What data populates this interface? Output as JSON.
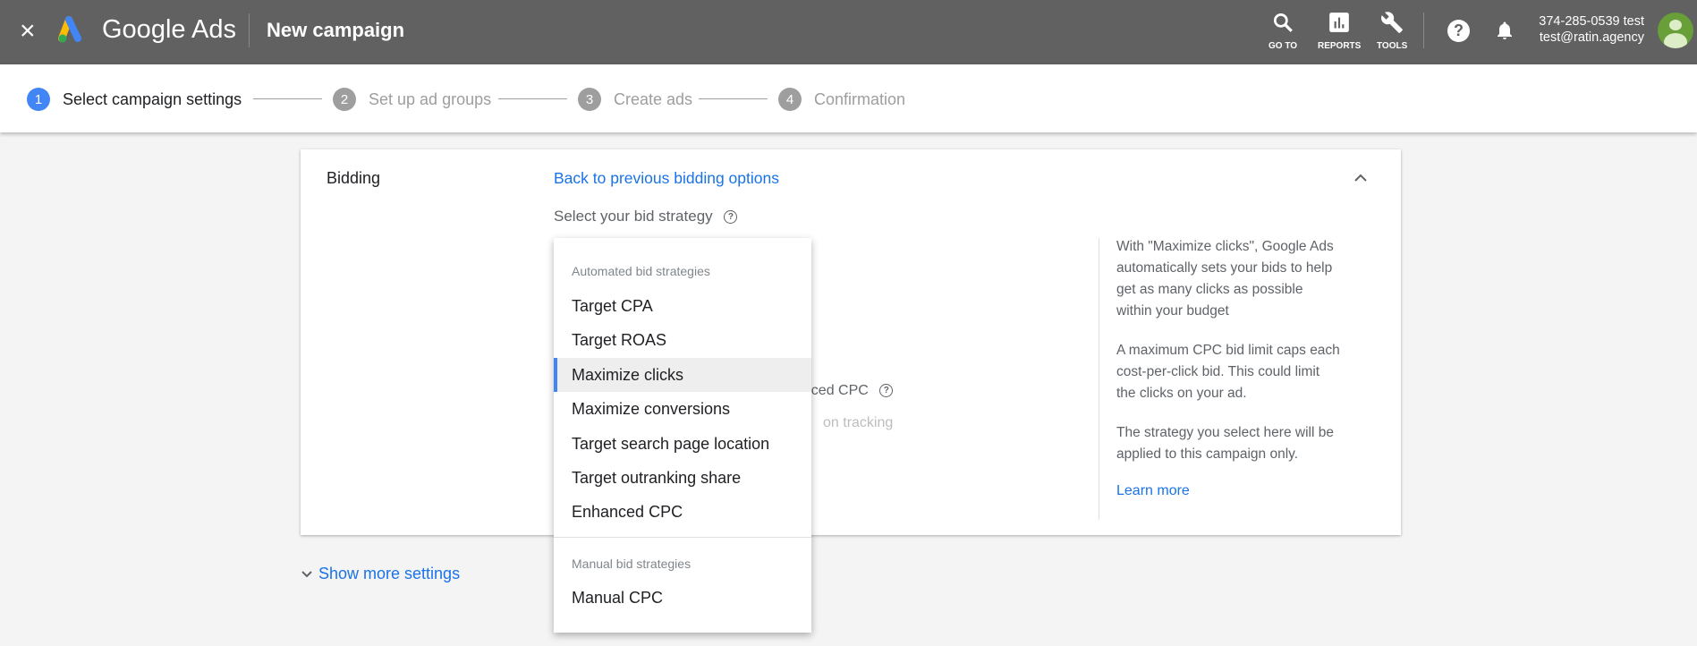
{
  "header": {
    "close_icon": "close-icon",
    "product_name": "Google Ads",
    "page_title": "New campaign",
    "goto_label": "GO TO",
    "reports_label": "REPORTS",
    "tools_label": "TOOLS",
    "account_id": "374-285-0539 test",
    "account_email": "test@ratin.agency"
  },
  "stepper": {
    "steps": [
      {
        "num": "1",
        "label": "Select campaign settings",
        "active": true
      },
      {
        "num": "2",
        "label": "Set up ad groups"
      },
      {
        "num": "3",
        "label": "Create ads"
      },
      {
        "num": "4",
        "label": "Confirmation"
      }
    ]
  },
  "bidding": {
    "section_label": "Bidding",
    "back_link": "Back to previous bidding options",
    "select_label": "Select your bid strategy",
    "behind_text_1": "anced CPC",
    "behind_text_2": "on tracking",
    "help": {
      "p1": "With \"Maximize clicks\", Google Ads automatically sets your bids to help get as many clicks as possible within your budget",
      "p2": "A maximum CPC bid limit caps each cost-per-click bid. This could limit the clicks on your ad.",
      "p3": "The strategy you select here will be applied to this campaign only.",
      "learn_more": "Learn more"
    }
  },
  "dropdown": {
    "automated_header": "Automated bid strategies",
    "automated": [
      "Target CPA",
      "Target ROAS",
      "Maximize clicks",
      "Maximize conversions",
      "Target search page location",
      "Target outranking share",
      "Enhanced CPC"
    ],
    "selected": "Maximize clicks",
    "manual_header": "Manual bid strategies",
    "manual": [
      "Manual CPC"
    ]
  },
  "show_more": "Show more settings",
  "colors": {
    "topbar": "#616161",
    "accent": "#4285f4",
    "link": "#1a73e8",
    "avatar": "#689f38"
  }
}
